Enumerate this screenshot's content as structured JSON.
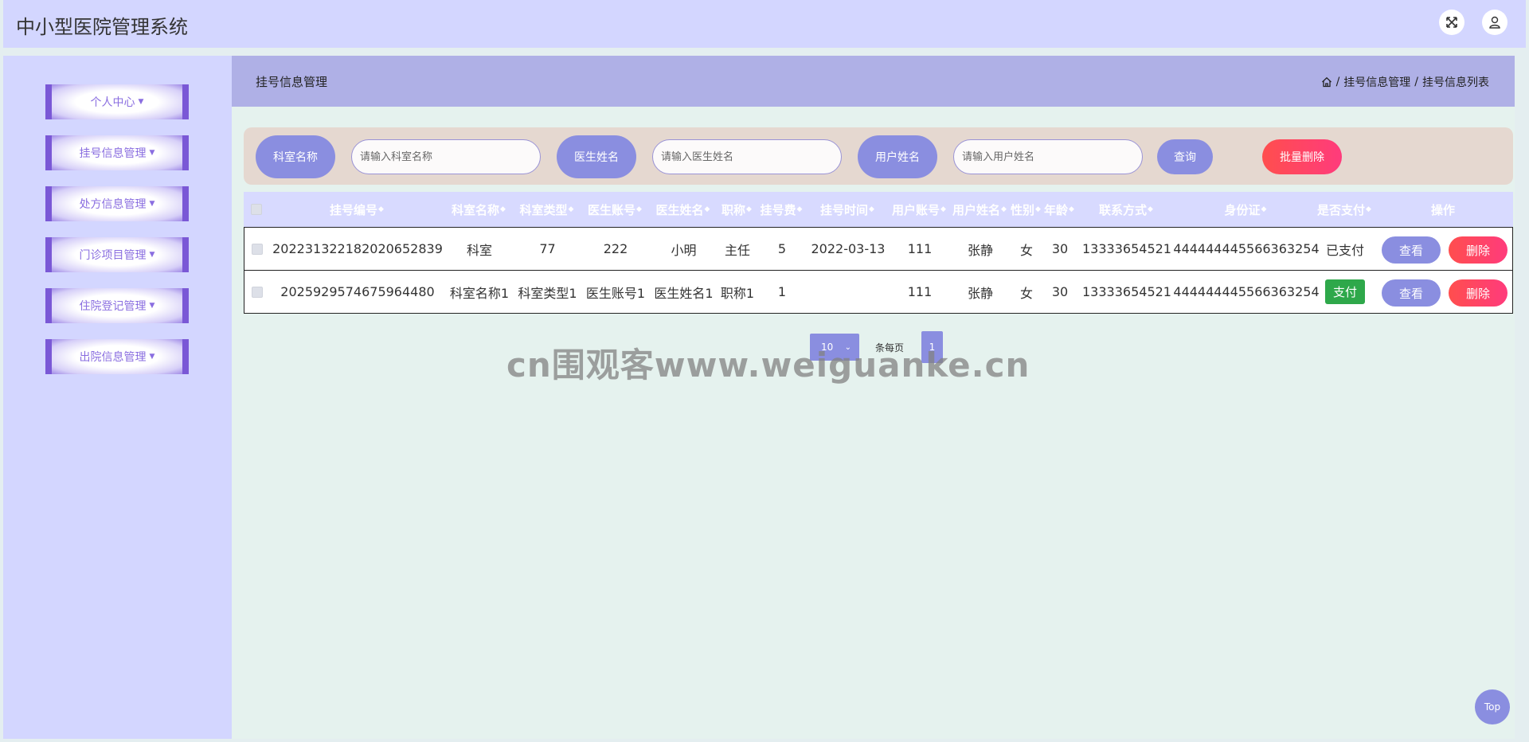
{
  "app": {
    "title": "中小型医院管理系统"
  },
  "header": {
    "fullscreen_icon": "expand-icon",
    "user_icon": "user-icon"
  },
  "sidebar": {
    "items": [
      {
        "label": "个人中心"
      },
      {
        "label": "挂号信息管理"
      },
      {
        "label": "处方信息管理"
      },
      {
        "label": "门诊项目管理"
      },
      {
        "label": "住院登记管理"
      },
      {
        "label": "出院信息管理"
      }
    ]
  },
  "page": {
    "title": "挂号信息管理",
    "breadcrumb": [
      "挂号信息管理",
      "挂号信息列表"
    ],
    "breadcrumb_sep": "/"
  },
  "search": {
    "dept_label": "科室名称",
    "dept_placeholder": "请输入科室名称",
    "doctor_label": "医生姓名",
    "doctor_placeholder": "请输入医生姓名",
    "user_label": "用户姓名",
    "user_placeholder": "请输入用户姓名",
    "query_button": "查询",
    "batch_delete_button": "批量删除"
  },
  "table": {
    "columns": [
      "挂号编号",
      "科室名称",
      "科室类型",
      "医生账号",
      "医生姓名",
      "职称",
      "挂号费",
      "挂号时间",
      "用户账号",
      "用户姓名",
      "性别",
      "年龄",
      "联系方式",
      "身份证",
      "是否支付",
      "操作"
    ],
    "rows": [
      {
        "id": "2022313221820206528​39",
        "dept": "科室",
        "dept_type": "77",
        "doctor_account": "222",
        "doctor_name": "小明",
        "title": "主任",
        "fee": "5",
        "time": "2022-03-13",
        "user_account": "111",
        "user_name": "张静",
        "gender": "女",
        "age": "30",
        "phone": "13333654521",
        "idcard": "444444445566363254",
        "paid": "已支付"
      },
      {
        "id": "2025929574675964480",
        "dept": "科室名称1",
        "dept_type": "科室类型1",
        "doctor_account": "医生账号1",
        "doctor_name": "医生姓名1",
        "title": "职称1",
        "fee": "1",
        "time": "",
        "user_account": "111",
        "user_name": "张静",
        "gender": "女",
        "age": "30",
        "phone": "13333654521",
        "idcard": "444444445566363254",
        "paid": "支付"
      }
    ],
    "view_button": "查看",
    "delete_button": "删除"
  },
  "pagination": {
    "page_size": "10",
    "per_page_label": "条每页",
    "current_page": "1"
  },
  "watermark": "cn围观客www.weiguanke.cn",
  "top_button": "Top",
  "colors": {
    "accent": "#8a8ee0",
    "danger": "#ff4e4e",
    "success": "#2ea84a",
    "header_bg": "#d3d6ff"
  }
}
